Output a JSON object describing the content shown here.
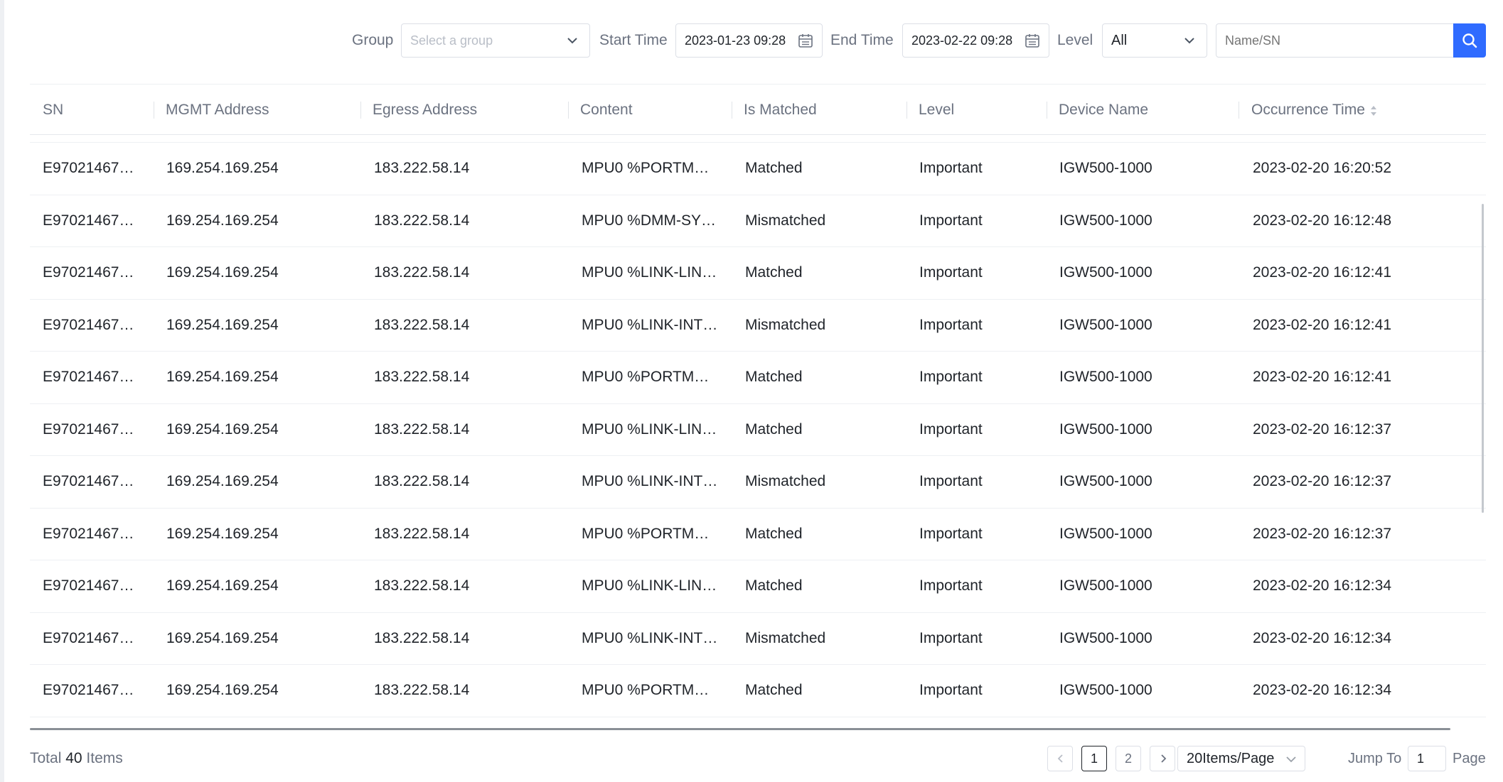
{
  "filters": {
    "group_label": "Group",
    "group_placeholder": "Select a group",
    "start_time_label": "Start Time",
    "start_time_value": "2023-01-23 09:28",
    "end_time_label": "End Time",
    "end_time_value": "2023-02-22 09:28",
    "level_label": "Level",
    "level_value": "All",
    "search_placeholder": "Name/SN"
  },
  "table": {
    "columns": [
      "SN",
      "MGMT Address",
      "Egress Address",
      "Content",
      "Is Matched",
      "Level",
      "Device Name",
      "Occurrence Time"
    ],
    "rows": [
      [
        "E97021467…",
        "169.254.169.254",
        "183.222.58.14",
        "MPU0 %PORTM…",
        "Matched",
        "Important",
        "IGW500-1000",
        "2023-02-20 16:20:52"
      ],
      [
        "E97021467…",
        "169.254.169.254",
        "183.222.58.14",
        "MPU0 %DMM-SY…",
        "Mismatched",
        "Important",
        "IGW500-1000",
        "2023-02-20 16:12:48"
      ],
      [
        "E97021467…",
        "169.254.169.254",
        "183.222.58.14",
        "MPU0 %LINK-LIN…",
        "Matched",
        "Important",
        "IGW500-1000",
        "2023-02-20 16:12:41"
      ],
      [
        "E97021467…",
        "169.254.169.254",
        "183.222.58.14",
        "MPU0 %LINK-INT…",
        "Mismatched",
        "Important",
        "IGW500-1000",
        "2023-02-20 16:12:41"
      ],
      [
        "E97021467…",
        "169.254.169.254",
        "183.222.58.14",
        "MPU0 %PORTM…",
        "Matched",
        "Important",
        "IGW500-1000",
        "2023-02-20 16:12:41"
      ],
      [
        "E97021467…",
        "169.254.169.254",
        "183.222.58.14",
        "MPU0 %LINK-LIN…",
        "Matched",
        "Important",
        "IGW500-1000",
        "2023-02-20 16:12:37"
      ],
      [
        "E97021467…",
        "169.254.169.254",
        "183.222.58.14",
        "MPU0 %LINK-INT…",
        "Mismatched",
        "Important",
        "IGW500-1000",
        "2023-02-20 16:12:37"
      ],
      [
        "E97021467…",
        "169.254.169.254",
        "183.222.58.14",
        "MPU0 %PORTM…",
        "Matched",
        "Important",
        "IGW500-1000",
        "2023-02-20 16:12:37"
      ],
      [
        "E97021467…",
        "169.254.169.254",
        "183.222.58.14",
        "MPU0 %LINK-LIN…",
        "Matched",
        "Important",
        "IGW500-1000",
        "2023-02-20 16:12:34"
      ],
      [
        "E97021467…",
        "169.254.169.254",
        "183.222.58.14",
        "MPU0 %LINK-INT…",
        "Mismatched",
        "Important",
        "IGW500-1000",
        "2023-02-20 16:12:34"
      ],
      [
        "E97021467…",
        "169.254.169.254",
        "183.222.58.14",
        "MPU0 %PORTM…",
        "Matched",
        "Important",
        "IGW500-1000",
        "2023-02-20 16:12:34"
      ]
    ]
  },
  "footer": {
    "total_prefix": "Total",
    "total_count": "40",
    "total_suffix": "Items",
    "pages": [
      "1",
      "2"
    ],
    "current_page": "1",
    "page_size": "20Items/Page",
    "jump_label": "Jump To",
    "jump_value": "1",
    "page_label": "Page"
  },
  "icons": {
    "group_dropdown": "chevron-down-icon",
    "start_calendar": "calendar-icon",
    "end_calendar": "calendar-icon",
    "level_dropdown": "chevron-down-icon",
    "search": "search-icon",
    "sort": "sort-icon",
    "prev": "chevron-left-icon",
    "next": "chevron-right-icon"
  },
  "colors": {
    "accent": "#2f6bff",
    "text": "#1f2329",
    "muted": "#6b7280",
    "border": "#dcdfe6"
  }
}
